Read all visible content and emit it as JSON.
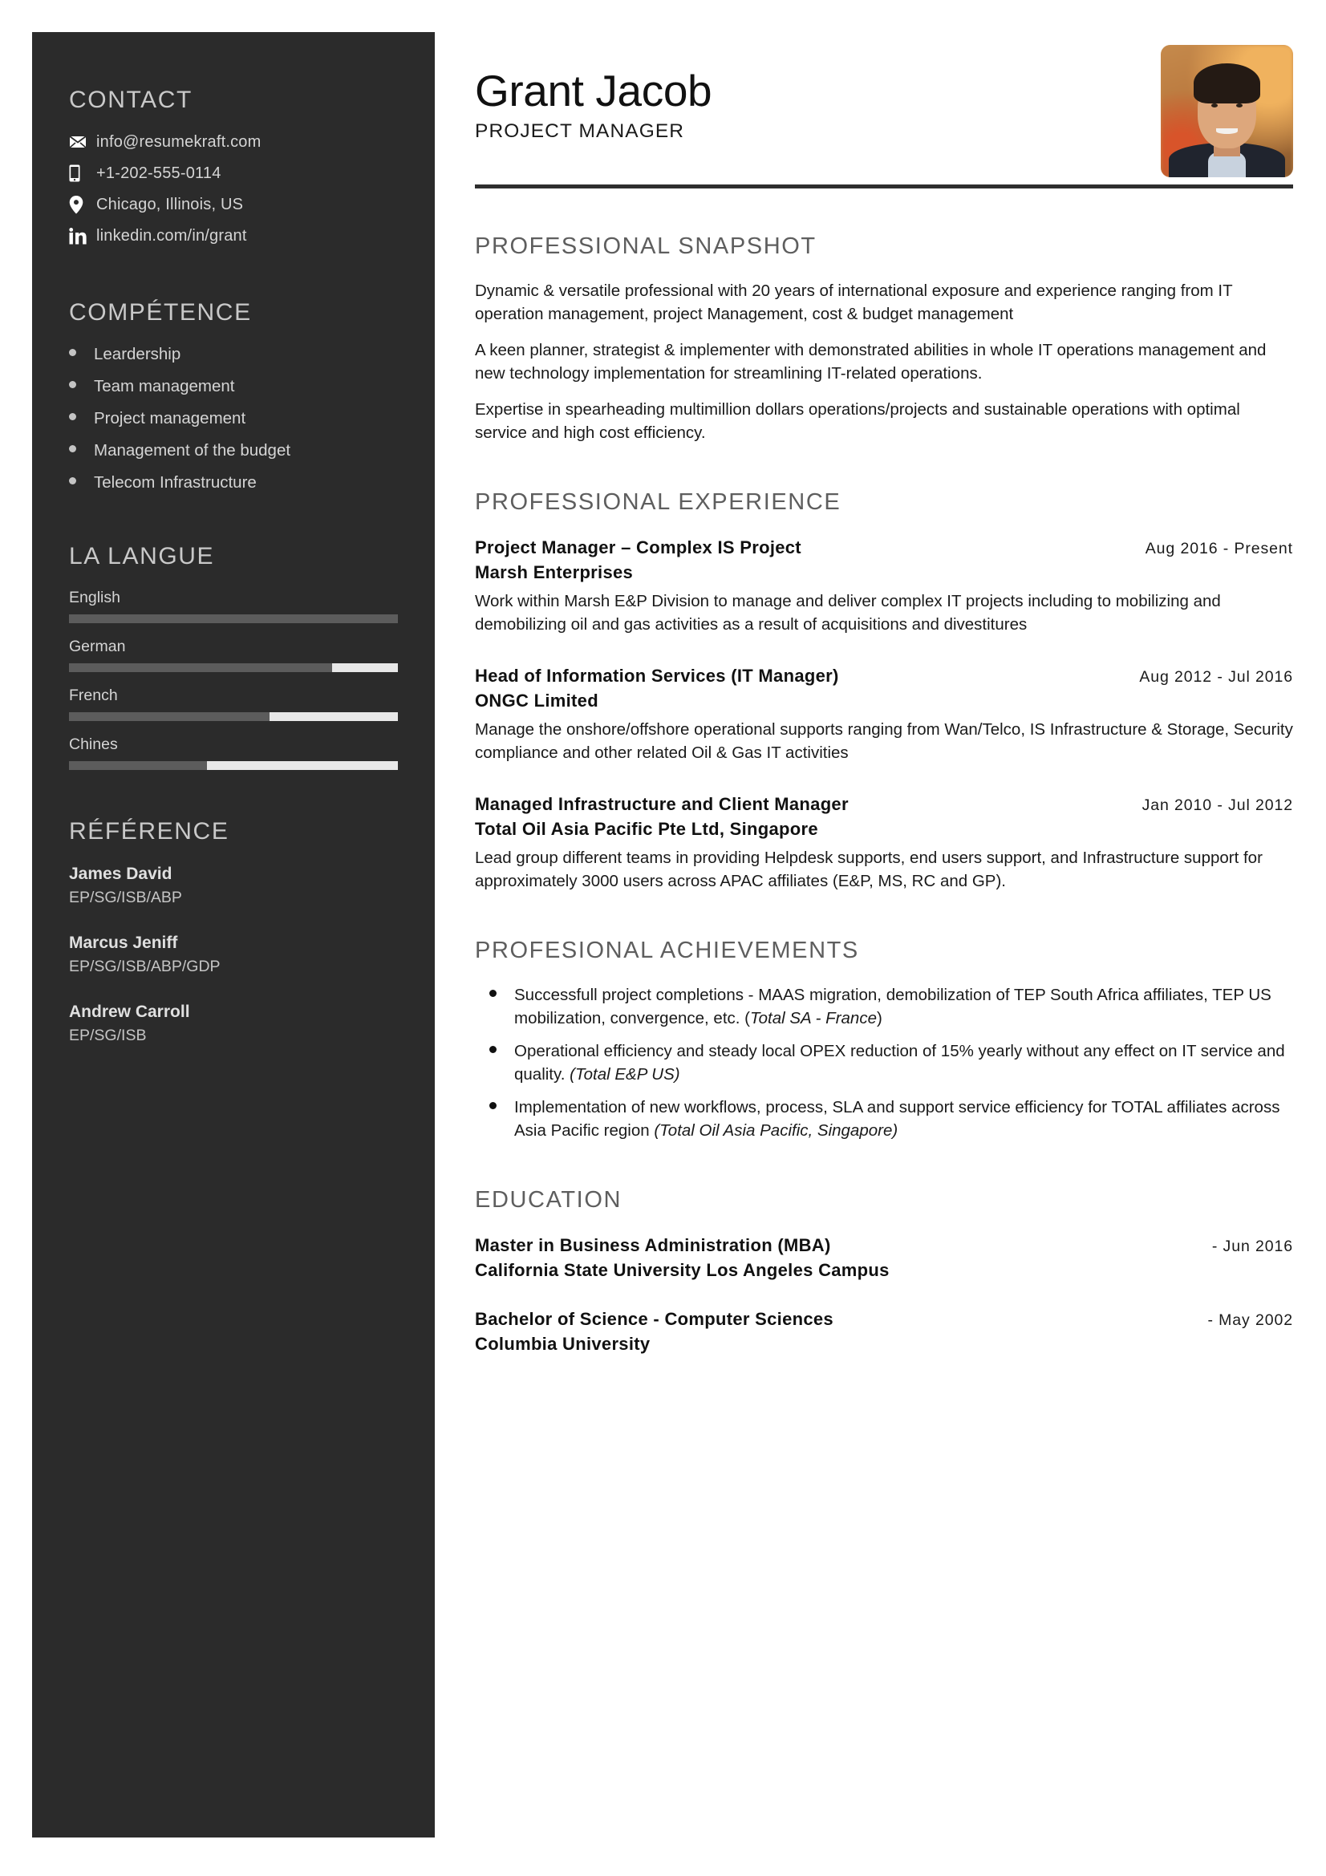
{
  "theme": {
    "sidebar_bg": "#2b2b2b",
    "page_bg": "#ffffff",
    "sidebar_heading": "#c9c9c9",
    "sidebar_text": "#d5d5d5",
    "section_heading": "#5e5e5e",
    "body_text": "#1a1a1a",
    "rule": "#2e2e2e",
    "bar_track": "#e8e8e8",
    "bar_fill": "#5c5c5c"
  },
  "header": {
    "name": "Grant Jacob",
    "title": "PROJECT MANAGER",
    "photo_alt": "portrait-photo"
  },
  "sidebar": {
    "contact": {
      "heading": "CONTACT",
      "items": [
        {
          "icon": "envelope-icon",
          "value": "info@resumekraft.com"
        },
        {
          "icon": "mobile-phone-icon",
          "value": "+1-202-555-0114"
        },
        {
          "icon": "map-pin-icon",
          "value": "Chicago, Illinois, US"
        },
        {
          "icon": "linkedin-icon",
          "value": "linkedin.com/in/grant"
        }
      ]
    },
    "competence": {
      "heading": "COMPÉTENCE",
      "items": [
        "Leardership",
        "Team management",
        "Project management",
        "Management of the budget",
        "Telecom Infrastructure"
      ]
    },
    "language": {
      "heading": "LA LANGUE",
      "items": [
        {
          "name": "English",
          "level": 100
        },
        {
          "name": "German",
          "level": 80
        },
        {
          "name": "French",
          "level": 61
        },
        {
          "name": "Chines",
          "level": 42
        }
      ]
    },
    "reference": {
      "heading": "RÉFÉRENCE",
      "items": [
        {
          "name": "James David",
          "role": "EP/SG/ISB/ABP"
        },
        {
          "name": "Marcus Jeniff",
          "role": "EP/SG/ISB/ABP/GDP"
        },
        {
          "name": "Andrew Carroll",
          "role": "EP/SG/ISB"
        }
      ]
    }
  },
  "main": {
    "snapshot": {
      "heading": "PROFESSIONAL SNAPSHOT",
      "paragraphs": [
        "Dynamic & versatile professional with  20 years of international exposure and experience ranging from IT operation management, project Management, cost & budget management",
        "A keen planner, strategist & implementer with demonstrated abilities in whole IT operations management and new technology implementation for streamlining IT-related operations.",
        "Expertise in spearheading multimillion dollars operations/projects and sustainable operations with optimal service and high cost efficiency."
      ]
    },
    "experience": {
      "heading": "PROFESSIONAL EXPERIENCE",
      "jobs": [
        {
          "title": "Project Manager – Complex IS Project",
          "date": "Aug 2016 - Present",
          "company": "Marsh Enterprises",
          "description": "Work within Marsh E&P Division to manage and deliver complex IT projects including  to mobilizing and demobilizing oil and gas activities as a result of acquisitions and divestitures"
        },
        {
          "title": "Head of Information Services (IT Manager)",
          "date": "Aug 2012 - Jul 2016",
          "company": "ONGC Limited",
          "description": "Manage the onshore/offshore operational supports ranging from Wan/Telco, IS Infrastructure & Storage, Security compliance and other related Oil & Gas IT activities"
        },
        {
          "title": "Managed Infrastructure and Client Manager",
          "date": "Jan 2010 - Jul 2012",
          "company": "Total Oil Asia Pacific Pte Ltd, Singapore",
          "description": "Lead group different teams in providing Helpdesk supports, end users support, and Infrastructure support for approximately 3000 users across APAC affiliates (E&P, MS, RC and GP)."
        }
      ]
    },
    "achievements": {
      "heading": "PROFESIONAL ACHIEVEMENTS",
      "items": [
        {
          "text": "Successfull project completions - MAAS migration, demobilization of TEP South Africa affiliates, TEP US mobilization, convergence, etc. (",
          "emphasis": "Total SA - France",
          "tail": ")"
        },
        {
          "text": "Operational efficiency and steady local OPEX reduction of 15% yearly without any effect on IT service and quality. ",
          "emphasis": "(Total E&P US)",
          "tail": ""
        },
        {
          "text": "Implementation of new workflows, process, SLA and support service efficiency for TOTAL affiliates across Asia Pacific region ",
          "emphasis": "(Total Oil Asia Pacific, Singapore)",
          "tail": ""
        }
      ]
    },
    "education": {
      "heading": "EDUCATION",
      "items": [
        {
          "degree": "Master in Business Administration (MBA)",
          "date": "- Jun 2016",
          "school": "California State University Los Angeles Campus"
        },
        {
          "degree": "Bachelor of Science - Computer Sciences",
          "date": "- May 2002",
          "school": "Columbia University"
        }
      ]
    }
  }
}
